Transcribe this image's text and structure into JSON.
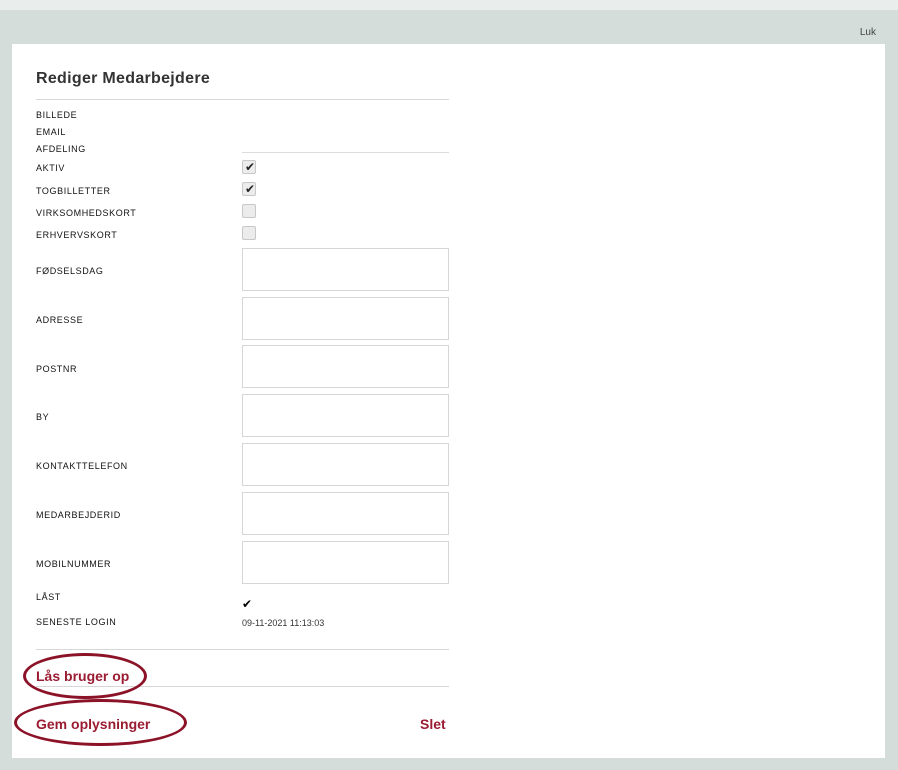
{
  "dialog": {
    "close_label": "Luk",
    "title": "Rediger Medarbejdere"
  },
  "fields": {
    "image_label": "BILLEDE",
    "email_label": "EMAIL",
    "department_label": "AFDELING",
    "active_label": "AKTIV",
    "active_checked": true,
    "train_tickets_label": "TOGBILLETTER",
    "train_tickets_checked": true,
    "company_card_label": "VIRKSOMHEDSKORT",
    "company_card_checked": false,
    "business_card_label": "ERHVERVSKORT",
    "business_card_checked": false,
    "birthday_label": "FØDSELSDAG",
    "birthday_value": "",
    "address_label": "ADRESSE",
    "address_value": "",
    "postal_code_label": "POSTNR",
    "postal_code_value": "",
    "city_label": "BY",
    "city_value": "",
    "contact_phone_label": "KONTAKTTELEFON",
    "contact_phone_value": "",
    "employee_id_label": "MEDARBEJDERID",
    "employee_id_value": "",
    "mobile_label": "MOBILNUMMER",
    "mobile_value": "",
    "locked_label": "LÅST",
    "locked_check": "✔",
    "last_login_label": "SENESTE LOGIN",
    "last_login_value": "09-11-2021 11:13:03"
  },
  "actions": {
    "unlock_user": "Lås bruger op",
    "save": "Gem oplysninger",
    "delete": "Slet"
  },
  "colors": {
    "accent": "#9a1b32",
    "annotation": "#8c1228",
    "frame": "#d4ddd9"
  }
}
